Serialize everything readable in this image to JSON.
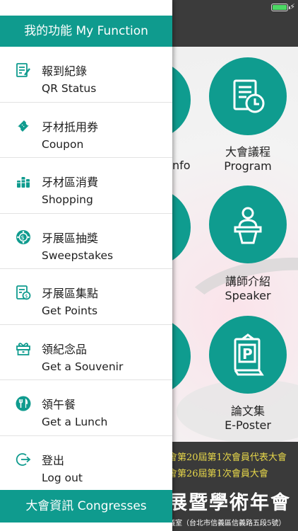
{
  "status_bar": {
    "battery_color": "#4cd964"
  },
  "background": {
    "tiles": [
      {
        "zh": "大會議程",
        "en": "Program"
      },
      {
        "zh": "講師介紹",
        "en": "Speaker"
      },
      {
        "zh": "論文集",
        "en": "E-Poster"
      }
    ],
    "partial_label": "nfo",
    "banner": {
      "line1": "會第20屆第1次會員代表大會",
      "line2": "會第26屆第1次會員大會",
      "title": "展暨學術年會",
      "address": "議室（台北市信義區信義路五段5號）"
    }
  },
  "drawer": {
    "header": "我的功能 My Function",
    "items": [
      {
        "zh": "報到紀錄",
        "en": "QR Status",
        "icon": "qr-status-icon"
      },
      {
        "zh": "牙材抵用券",
        "en": "Coupon",
        "icon": "ticket-icon"
      },
      {
        "zh": "牙材區消費",
        "en": "Shopping",
        "icon": "coins-icon"
      },
      {
        "zh": "牙展區抽獎",
        "en": "Sweepstakes",
        "icon": "sweepstakes-icon"
      },
      {
        "zh": "牙展區集點",
        "en": "Get Points",
        "icon": "points-icon"
      },
      {
        "zh": "領紀念品",
        "en": "Get a Souvenir",
        "icon": "gift-icon"
      },
      {
        "zh": "領午餐",
        "en": "Get a Lunch",
        "icon": "lunch-icon"
      },
      {
        "zh": "登出",
        "en": "Log out",
        "icon": "logout-icon"
      }
    ],
    "footer": "大會資訊 Congresses"
  },
  "colors": {
    "accent": "#0f9b8e",
    "header_text": "#ffffff"
  }
}
